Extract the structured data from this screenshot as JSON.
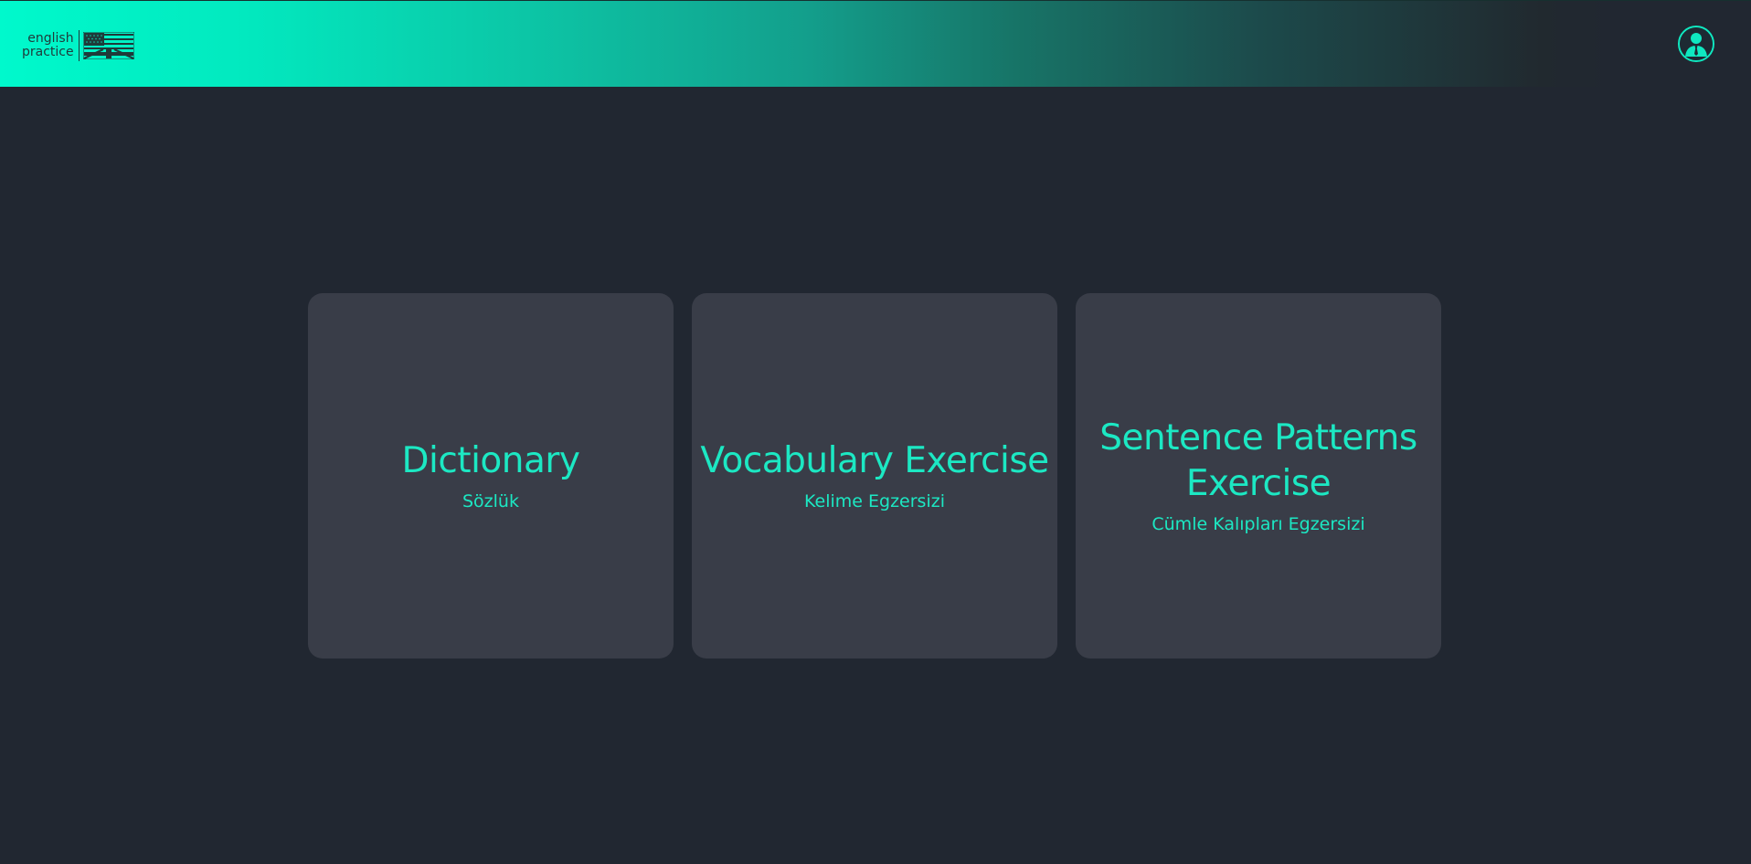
{
  "header": {
    "logo_line1": "english",
    "logo_line2": "practice",
    "gradient_start": "#00f9cc",
    "gradient_end": "#212731"
  },
  "user": {
    "avatar_icon": "user-icon"
  },
  "cards": [
    {
      "title": "Dictionary",
      "subtitle": "Sözlük"
    },
    {
      "title": "Vocabulary Exercise",
      "subtitle": "Kelime Egzersizi"
    },
    {
      "title": "Sentence Patterns Exercise",
      "subtitle": "Cümle Kalıpları Egzersizi"
    }
  ],
  "colors": {
    "background": "#212731",
    "card_background": "#393d48",
    "accent": "#1ce8c3"
  }
}
